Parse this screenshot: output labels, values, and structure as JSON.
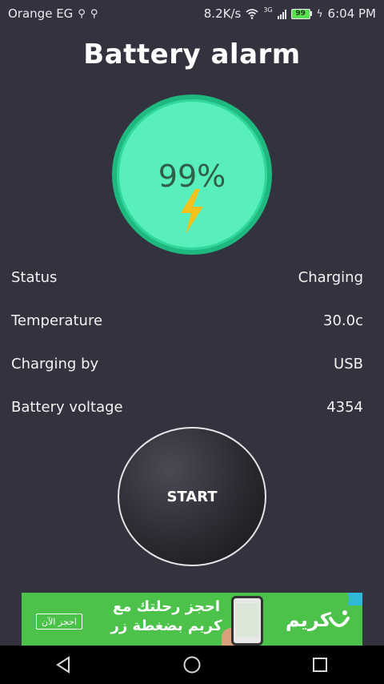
{
  "status_bar": {
    "carrier": "Orange EG",
    "usb_icons": [
      "usb-icon",
      "usb-icon"
    ],
    "net_speed": "8.2K/s",
    "network_type": "3G",
    "battery_level": "99",
    "time": "6:04 PM"
  },
  "app": {
    "title": "Battery alarm",
    "gauge": {
      "percent_text": "99%",
      "fill_color": "#58efbd",
      "ring_color": "#1db97f",
      "bolt_color": "#f4c21a"
    },
    "stats": [
      {
        "label": "Status",
        "value": "Charging"
      },
      {
        "label": "Temperature",
        "value": "30.0c"
      },
      {
        "label": "Charging by",
        "value": "USB"
      },
      {
        "label": "Battery voltage",
        "value": "4354"
      }
    ],
    "start_label": "START"
  },
  "ad": {
    "cta": "احجز الآن",
    "headline_line1": "احجز رحلتك مع",
    "headline_line2": "كريم بضغطة زر",
    "brand": "كريم",
    "background_color": "#4cc24b"
  },
  "nav": {
    "back": "back-icon",
    "home": "home-icon",
    "recents": "recents-icon"
  }
}
